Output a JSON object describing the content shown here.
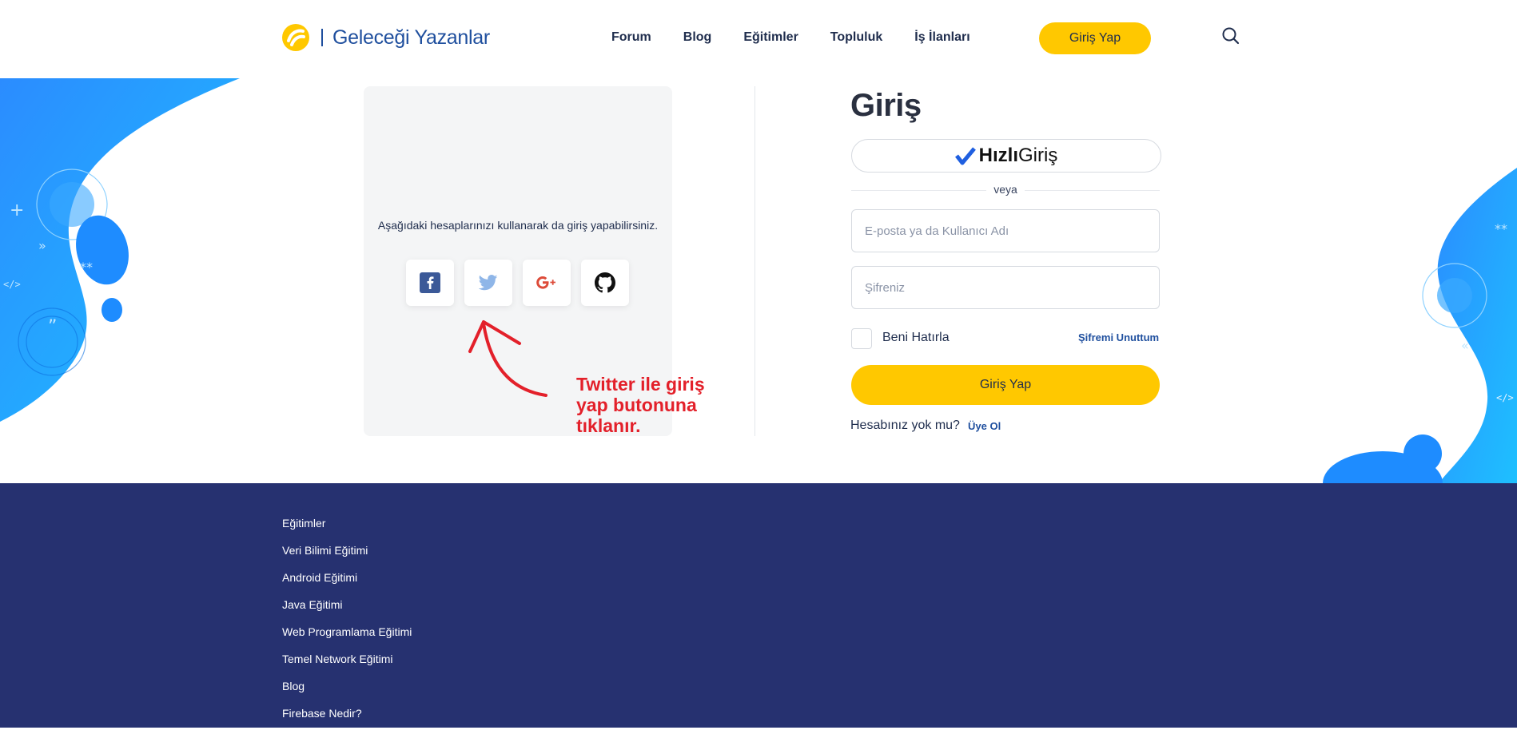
{
  "brand": {
    "name": "Geleceği Yazanlar"
  },
  "nav": {
    "items": [
      {
        "label": "Forum"
      },
      {
        "label": "Blog"
      },
      {
        "label": "Eğitimler"
      },
      {
        "label": "Topluluk"
      },
      {
        "label": "İş İlanları"
      }
    ],
    "login_label": "Giriş Yap"
  },
  "social": {
    "text": "Aşağıdaki hesaplarınızı kullanarak da giriş yapabilirsiniz.",
    "providers": [
      "facebook-icon",
      "twitter-icon",
      "google-plus-icon",
      "github-icon"
    ]
  },
  "login": {
    "title": "Giriş",
    "quick_bold": "Hızlı",
    "quick_light": "Giriş",
    "or": "veya",
    "email_placeholder": "E-posta ya da Kullanıcı Adı",
    "password_placeholder": "Şifreniz",
    "remember": "Beni Hatırla",
    "forgot": "Şifremi Unuttum",
    "submit": "Giriş Yap",
    "signup_question": "Hesabınız yok mu?",
    "signup_link": "Üye Ol"
  },
  "annotation": {
    "lines": [
      "Twitter ile giriş",
      "yap butonuna",
      "tıklanır."
    ]
  },
  "footer": {
    "links": [
      {
        "label": "Eğitimler"
      },
      {
        "label": "Veri Bilimi Eğitimi"
      },
      {
        "label": "Android Eğitimi"
      },
      {
        "label": "Java Eğitimi"
      },
      {
        "label": "Web Programlama Eğitimi"
      },
      {
        "label": "Temel Network Eğitimi"
      },
      {
        "label": "Blog"
      },
      {
        "label": "Firebase Nedir?"
      }
    ]
  },
  "colors": {
    "accent": "#ffc800",
    "brand_blue": "#1f4f9e",
    "footer_bg": "#263170",
    "decor_blue": "#1e9bff",
    "annotation_red": "#e3202a"
  }
}
